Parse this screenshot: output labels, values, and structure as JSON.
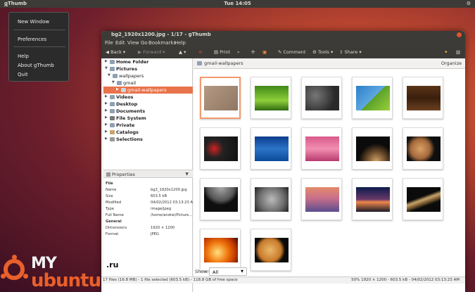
{
  "topbar": {
    "app_name_first": "g",
    "app_name_rest": "Thumb",
    "clock": "Tue 14:05",
    "power_icon": "power-icon"
  },
  "app_menu": {
    "items": [
      "New Window",
      "Preferences",
      "Help",
      "About gThumb",
      "Quit"
    ]
  },
  "window": {
    "title": "bg2_1920x1200.jpg - 1/17 - gThumb",
    "menu": [
      "File",
      "Edit",
      "View",
      "Go",
      "Bookmarks",
      "Help"
    ],
    "toolbar": {
      "back": "Back",
      "forward": "Forward",
      "print": "Print",
      "comment": "Comment",
      "tools": "Tools",
      "share": "Share"
    }
  },
  "tree": [
    {
      "label": "Home Folder",
      "expanded": false
    },
    {
      "label": "Pictures",
      "expanded": true
    },
    {
      "label": "wallpapers",
      "expanded": true
    },
    {
      "label": "gmail",
      "expanded": true
    },
    {
      "label": "gmail-wallpapers",
      "selected": true
    },
    {
      "label": "Videos",
      "expanded": false
    },
    {
      "label": "Desktop",
      "expanded": false
    },
    {
      "label": "Documents",
      "expanded": false
    },
    {
      "label": "File System",
      "expanded": false
    },
    {
      "label": "Private",
      "expanded": false
    },
    {
      "label": "Catalogs",
      "expanded": false
    },
    {
      "label": "Selections",
      "expanded": false
    }
  ],
  "properties": {
    "header": "Properties",
    "rows": [
      {
        "k": "File",
        "v": "",
        "section": true
      },
      {
        "k": "Name",
        "v": "bg2_1920x1200.jpg"
      },
      {
        "k": "Size",
        "v": "603.5 kB"
      },
      {
        "k": "Modified",
        "v": "04/02/2012 03:13:23 AM"
      },
      {
        "k": "Type",
        "v": "image/jpeg"
      },
      {
        "k": "Full Name",
        "v": "/home/andrei/Picture..."
      },
      {
        "k": "General",
        "v": "",
        "section": true
      },
      {
        "k": "Dimensions",
        "v": "1920 × 1200"
      },
      {
        "k": "Format",
        "v": "JPEG"
      }
    ]
  },
  "location": {
    "folder": "gmail-wallpapers",
    "organize": "Organize"
  },
  "thumbnails": [
    {
      "name": "wood-light",
      "selected": true,
      "bg": "linear-gradient(135deg,#b49a83,#8f7663)"
    },
    {
      "name": "grass",
      "bg": "linear-gradient(180deg,#3f8a18,#8fcf3a 60%,#2e6a10)"
    },
    {
      "name": "pebbles",
      "bg": "radial-gradient(circle at 30% 40%,#777 0,#2a2a2a 70%)"
    },
    {
      "name": "leaves-sky",
      "bg": "linear-gradient(135deg,#2a7ec9 0,#5fa9e0 50%,#5aa12a 50%,#9ccf3a 100%)"
    },
    {
      "name": "dark-wood",
      "bg": "linear-gradient(180deg,#5a3418,#3a1f0d 50%,#6b4020)"
    },
    {
      "name": "balls",
      "bg": "radial-gradient(circle at 30% 50%,#c22 0,#222 35%,#111 100%)"
    },
    {
      "name": "ocean",
      "bg": "linear-gradient(180deg,#0b3c8c,#2c74c7 50%,#0b4a9a)"
    },
    {
      "name": "pink-sunset",
      "bg": "linear-gradient(180deg,#d85a8a,#f28fb0 50%,#b73a6f)"
    },
    {
      "name": "planet-dark",
      "bg": "radial-gradient(circle at 60% 100%,#d2a36a 0,#6b4a2a 30%,#0b0b0b 55%)"
    },
    {
      "name": "mars",
      "bg": "radial-gradient(circle at 40% 50%,#d9a066 0,#a66a3c 40%,#0e0e0e 62%)"
    },
    {
      "name": "moon-edge",
      "bg": "radial-gradient(circle at 50% 0%,#aaa 0,#555 45%,#0e0e0e 60%)"
    },
    {
      "name": "moon-surface",
      "bg": "radial-gradient(circle at 50% 50%,#bbb 0,#6c6c6c 60%,#222 100%)"
    },
    {
      "name": "purple-sunset",
      "bg": "linear-gradient(180deg,#e48a6b,#c86f8a 45%,#5b4d8f)"
    },
    {
      "name": "dusk-horizon",
      "bg": "linear-gradient(180deg,#0b1a4a,#6a3a6a 50%,#f0884a 60%,#1a1a2a)"
    },
    {
      "name": "saturn",
      "bg": "linear-gradient(160deg,#0b0b0b 0,#0b0b0b 40%,#c9a46a 50%,#7a5a30 60%,#0b0b0b 70%)"
    },
    {
      "name": "sun",
      "bg": "radial-gradient(circle at 40% 60%,#ffe080 0,#f07a10 40%,#c43a00 70%,#3a0a00 100%)"
    },
    {
      "name": "venus",
      "bg": "radial-gradient(circle at 45% 50%,#e9b86a 0,#c97a2a 50%,#0b0b0b 68%)"
    }
  ],
  "show_filter": {
    "label": "Show:",
    "value": "All"
  },
  "status": {
    "left": "17 files (16.8 MB) - 1 file selected (603.5 kB) - 118.8 GB of free space",
    "right": "50%  1920 × 1200 - 603.5 kB - 04/02/2012 03:13:23 AM"
  },
  "watermark": {
    "my": "MY",
    "ubuntu": "ubuntu",
    "ru": ".ru"
  }
}
